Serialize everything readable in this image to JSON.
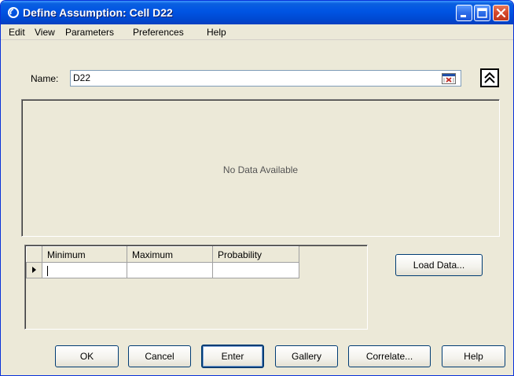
{
  "window": {
    "title": "Define Assumption: Cell D22"
  },
  "menu": {
    "items": [
      "Edit",
      "View",
      "Parameters",
      "Preferences",
      "Help"
    ]
  },
  "name": {
    "label": "Name:",
    "value": "D22"
  },
  "chart": {
    "empty_text": "No Data Available"
  },
  "grid": {
    "columns": [
      "Minimum",
      "Maximum",
      "Probability"
    ],
    "rows": [
      [
        "",
        "",
        ""
      ]
    ]
  },
  "buttons": {
    "load_data": "Load Data...",
    "ok": "OK",
    "cancel": "Cancel",
    "enter": "Enter",
    "gallery": "Gallery",
    "correlate": "Correlate...",
    "help": "Help"
  },
  "colors": {
    "titlebar": "#0054e3",
    "dialog_bg": "#ece9d8",
    "close_button": "#d4472a"
  },
  "icons": [
    "crystal-ball-icon",
    "minimize-icon",
    "maximize-icon",
    "close-icon",
    "cell-reference-icon",
    "collapse-up-icon",
    "row-pointer-icon"
  ]
}
